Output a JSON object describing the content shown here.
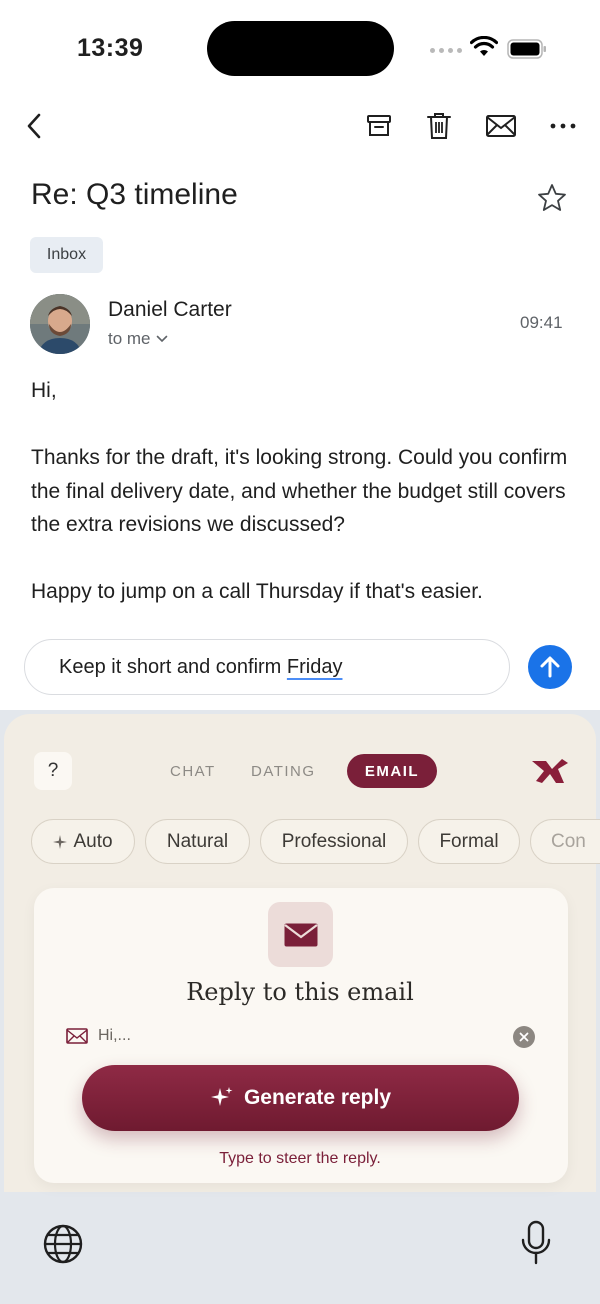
{
  "status_bar": {
    "time": "13:39"
  },
  "email": {
    "subject": "Re: Q3 timeline",
    "label": "Inbox",
    "sender": "Daniel Carter",
    "recipient": "to me",
    "time": "09:41",
    "greeting": "Hi,",
    "paragraph1": "Thanks for the draft, it's looking strong. Could you confirm the final delivery date, and whether the budget still covers the extra revisions we discussed?",
    "paragraph2": "Happy to jump on a call Thursday if that's easier."
  },
  "prompt": {
    "text_prefix": "Keep it short and confirm ",
    "text_underlined": "Friday"
  },
  "assistant": {
    "help_label": "?",
    "tabs": [
      {
        "label": "CHAT",
        "active": false
      },
      {
        "label": "DATING",
        "active": false
      },
      {
        "label": "EMAIL",
        "active": true
      }
    ],
    "tones": [
      {
        "label": "Auto",
        "icon": "sparkle-icon"
      },
      {
        "label": "Natural"
      },
      {
        "label": "Professional"
      },
      {
        "label": "Formal"
      },
      {
        "label": "Con"
      }
    ],
    "card_title": "Reply to this email",
    "preview_text": "Hi,...",
    "generate_label": "Generate reply",
    "hint": "Type to steer the reply."
  },
  "colors": {
    "accent": "#7a1f39",
    "send_blue": "#1a73e8",
    "panel_bg": "#f2ede4"
  }
}
